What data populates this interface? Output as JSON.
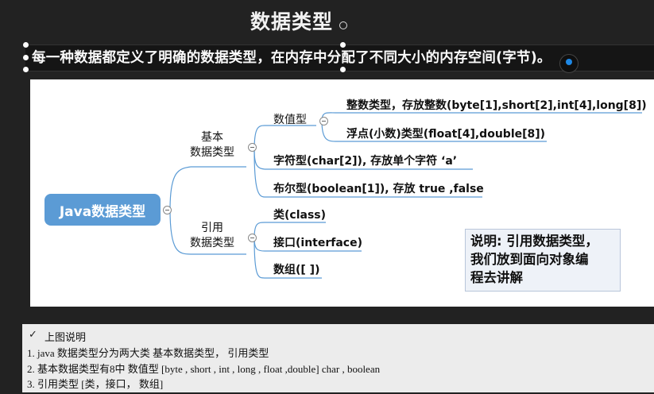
{
  "slide": {
    "title": "数据类型",
    "subtitle": "每一种数据都定义了明确的数据类型，在内存中分配了不同大小的内存空间(字节)。"
  },
  "diagram": {
    "root": "Java数据类型",
    "basic": {
      "line1": "基本",
      "line2": "数据类型"
    },
    "numeric": "数值型",
    "integer": "整数类型，存放整数(byte[1],short[2],int[4],long[8])",
    "float": "浮点(小数)类型(float[4],double[8])",
    "char": "字符型(char[2]), 存放单个字符 ‘a’",
    "boolean": "布尔型(boolean[1]), 存放 true ,false",
    "reference": {
      "line1": "引用",
      "line2": "数据类型"
    },
    "class": "类(class)",
    "interface": "接口(interface)",
    "array": "数组([ ])",
    "note": [
      "说明: 引用数据类型，",
      "我们放到面向对象编",
      "程去讲解"
    ]
  },
  "footer": {
    "heading": "上图说明",
    "line1": "1. java 数据类型分为两大类 基本数据类型， 引用类型",
    "line2": "2. 基本数据类型有8中 数值型 [byte , short , int , long , float ,double] char , boolean",
    "line3": "3. 引用类型 [类，接口， 数组]"
  },
  "colors": {
    "root_fill": "#5b9bd5",
    "connector": "#5b9bd5",
    "background": "#222222"
  }
}
